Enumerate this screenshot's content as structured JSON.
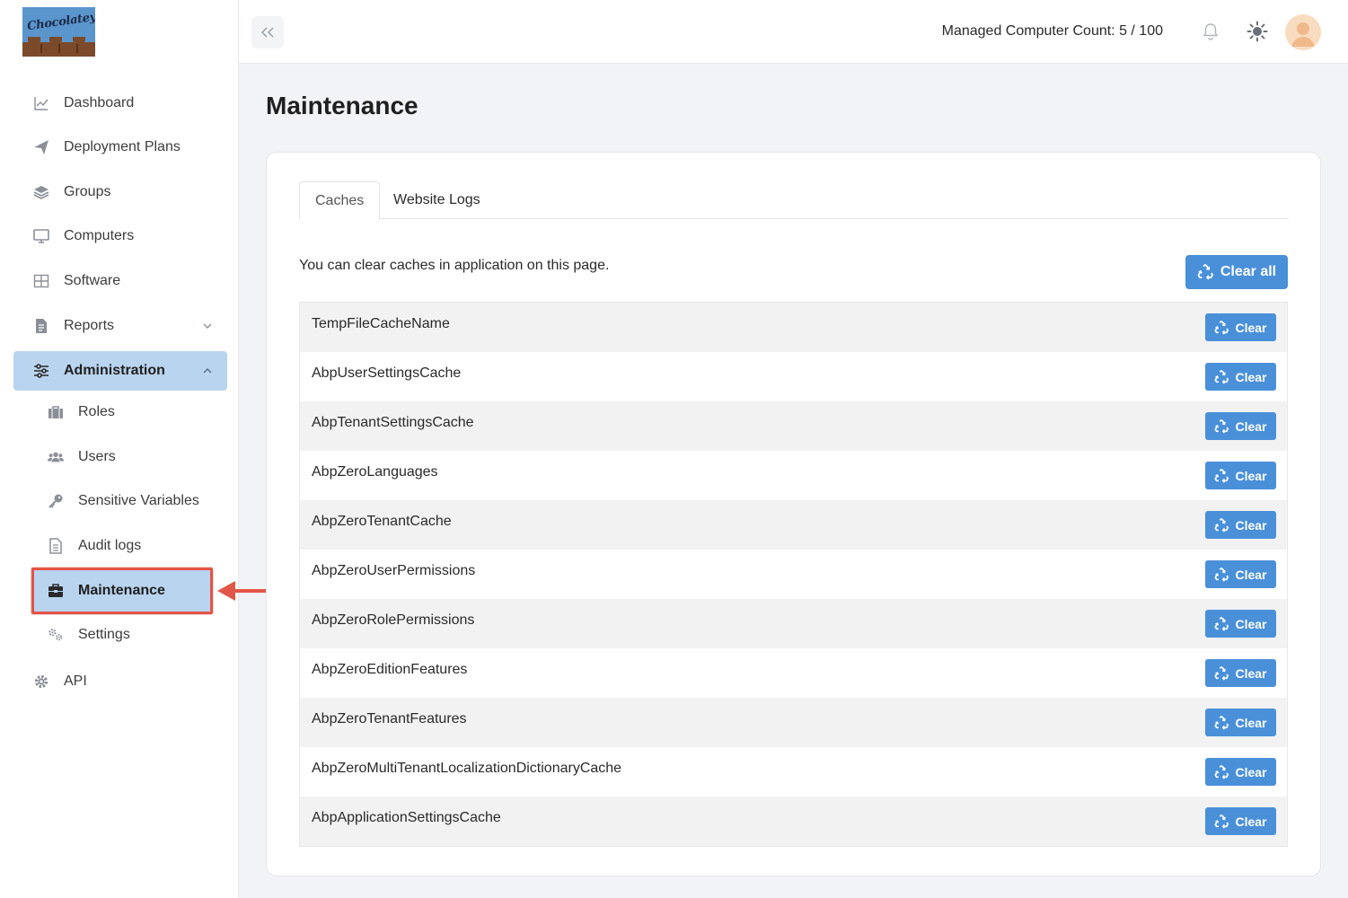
{
  "brand": {
    "logo_text": "Chocolatey"
  },
  "sidebar": {
    "items": [
      {
        "label": "Dashboard",
        "icon": "chart-line-icon"
      },
      {
        "label": "Deployment Plans",
        "icon": "paper-plane-icon"
      },
      {
        "label": "Groups",
        "icon": "layers-icon"
      },
      {
        "label": "Computers",
        "icon": "monitor-icon"
      },
      {
        "label": "Software",
        "icon": "grid-icon"
      },
      {
        "label": "Reports",
        "icon": "report-icon",
        "expandable": true
      },
      {
        "label": "Administration",
        "icon": "sliders-icon",
        "expanded": true,
        "active": true
      },
      {
        "label": "API",
        "icon": "gear-icon"
      }
    ],
    "admin_subitems": [
      {
        "label": "Roles",
        "icon": "briefcase-icon"
      },
      {
        "label": "Users",
        "icon": "users-icon"
      },
      {
        "label": "Sensitive Variables",
        "icon": "key-icon"
      },
      {
        "label": "Audit logs",
        "icon": "document-icon"
      },
      {
        "label": "Maintenance",
        "icon": "toolbox-icon",
        "active": true
      },
      {
        "label": "Settings",
        "icon": "cogs-icon"
      }
    ]
  },
  "header": {
    "managed_count": "Managed Computer Count: 5 / 100"
  },
  "page": {
    "title": "Maintenance",
    "tabs": [
      {
        "label": "Caches",
        "active": true
      },
      {
        "label": "Website Logs",
        "active": false
      }
    ],
    "intro": "You can clear caches in application on this page.",
    "clear_all_label": "Clear all",
    "clear_label": "Clear",
    "caches": [
      "TempFileCacheName",
      "AbpUserSettingsCache",
      "AbpTenantSettingsCache",
      "AbpZeroLanguages",
      "AbpZeroTenantCache",
      "AbpZeroUserPermissions",
      "AbpZeroRolePermissions",
      "AbpZeroEditionFeatures",
      "AbpZeroTenantFeatures",
      "AbpZeroMultiTenantLocalizationDictionaryCache",
      "AbpApplicationSettingsCache"
    ]
  },
  "colors": {
    "accent": "#4a90d9",
    "active_nav": "#b9d4ee",
    "highlight": "#e25548"
  }
}
